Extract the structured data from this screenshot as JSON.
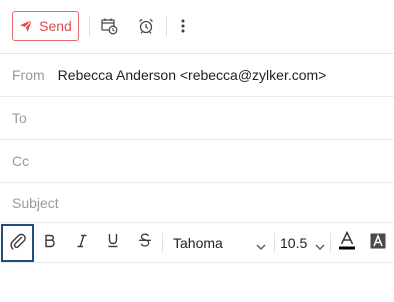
{
  "toolbar": {
    "send_label": "Send",
    "accent_color": "#e2494a",
    "icons": [
      "send-icon",
      "schedule-send-icon",
      "reminder-alarm-icon",
      "more-options-icon"
    ]
  },
  "header": {
    "from_label": "From",
    "from_value": "Rebecca Anderson <rebecca@zylker.com>",
    "to_label": "To",
    "cc_label": "Cc",
    "subject_label": "Subject"
  },
  "format_toolbar": {
    "font_family": "Tahoma",
    "font_size": "10.5",
    "focus_outline_color": "#1f4e79",
    "icons": [
      "attachment-icon",
      "bold-icon",
      "italic-icon",
      "underline-icon",
      "strikethrough-icon",
      "chevron-down-icon",
      "font-color-icon",
      "highlight-color-icon"
    ]
  }
}
